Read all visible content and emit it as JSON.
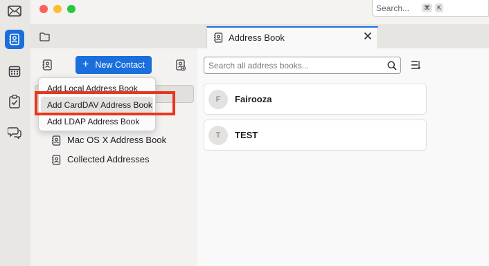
{
  "window": {
    "traffic_lights": {
      "close": "#ff5f57",
      "minimize": "#febc2e",
      "zoom": "#28c840"
    },
    "search": {
      "placeholder": "Search...",
      "shortcut_keys": [
        "⌘",
        "K"
      ]
    }
  },
  "spaces": [
    "mail-icon",
    "address-book-icon",
    "calendar-icon",
    "tasks-icon",
    "chat-icon"
  ],
  "tab": {
    "title": "Address Book"
  },
  "toolbar": {
    "new_contact_label": "New Contact"
  },
  "menu": {
    "items": [
      "Add Local Address Book",
      "Add CardDAV Address Book",
      "Add LDAP Address Book"
    ],
    "highlighted_index": 1
  },
  "address_books": {
    "items": [
      "Mac OS X Address Book",
      "Collected Addresses"
    ]
  },
  "list": {
    "search_placeholder": "Search all address books...",
    "contacts": [
      {
        "initial": "F",
        "name": "Fairooza"
      },
      {
        "initial": "T",
        "name": "TEST"
      }
    ]
  },
  "colors": {
    "accent": "#1a6fdc",
    "highlight_box": "#e8361d"
  }
}
